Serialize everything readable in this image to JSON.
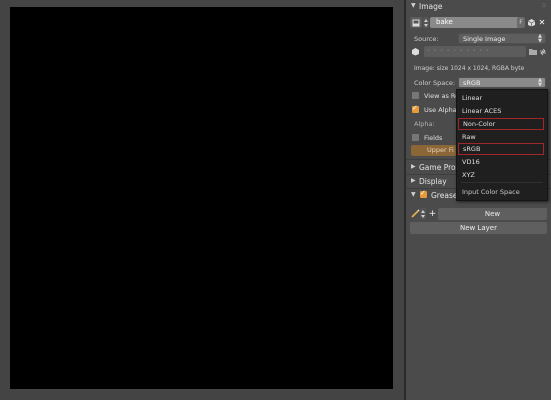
{
  "image_panel": {
    "title": "Image",
    "image_name": "bake",
    "fake_user_label": "F",
    "source_label": "Source:",
    "source_value": "Single Image",
    "filepath_placeholder": "• • • • • • • • • •",
    "info": "Image: size 1024 x 1024, RGBA byte",
    "color_space_label": "Color Space:",
    "color_space_value": "sRGB",
    "view_as_render_label": "View as Re",
    "use_alpha_label": "Use Alpha",
    "alpha_label": "Alpha:",
    "fields_label": "Fields",
    "upper_first_label": "Upper Fi"
  },
  "collapsed_panels": {
    "game_properties": "Game Prop",
    "display": "Display",
    "grease_pencil": "Grease"
  },
  "grease_pencil": {
    "new_button": "New",
    "new_layer_button": "New Layer"
  },
  "color_space_menu": {
    "items": [
      "Linear",
      "Linear ACES",
      "Non-Color",
      "Raw",
      "sRGB",
      "VD16",
      "XYZ"
    ],
    "footer": "Input Color Space"
  },
  "colors": {
    "accent_check": "#e69a3a",
    "highlight_border": "#a02828"
  }
}
